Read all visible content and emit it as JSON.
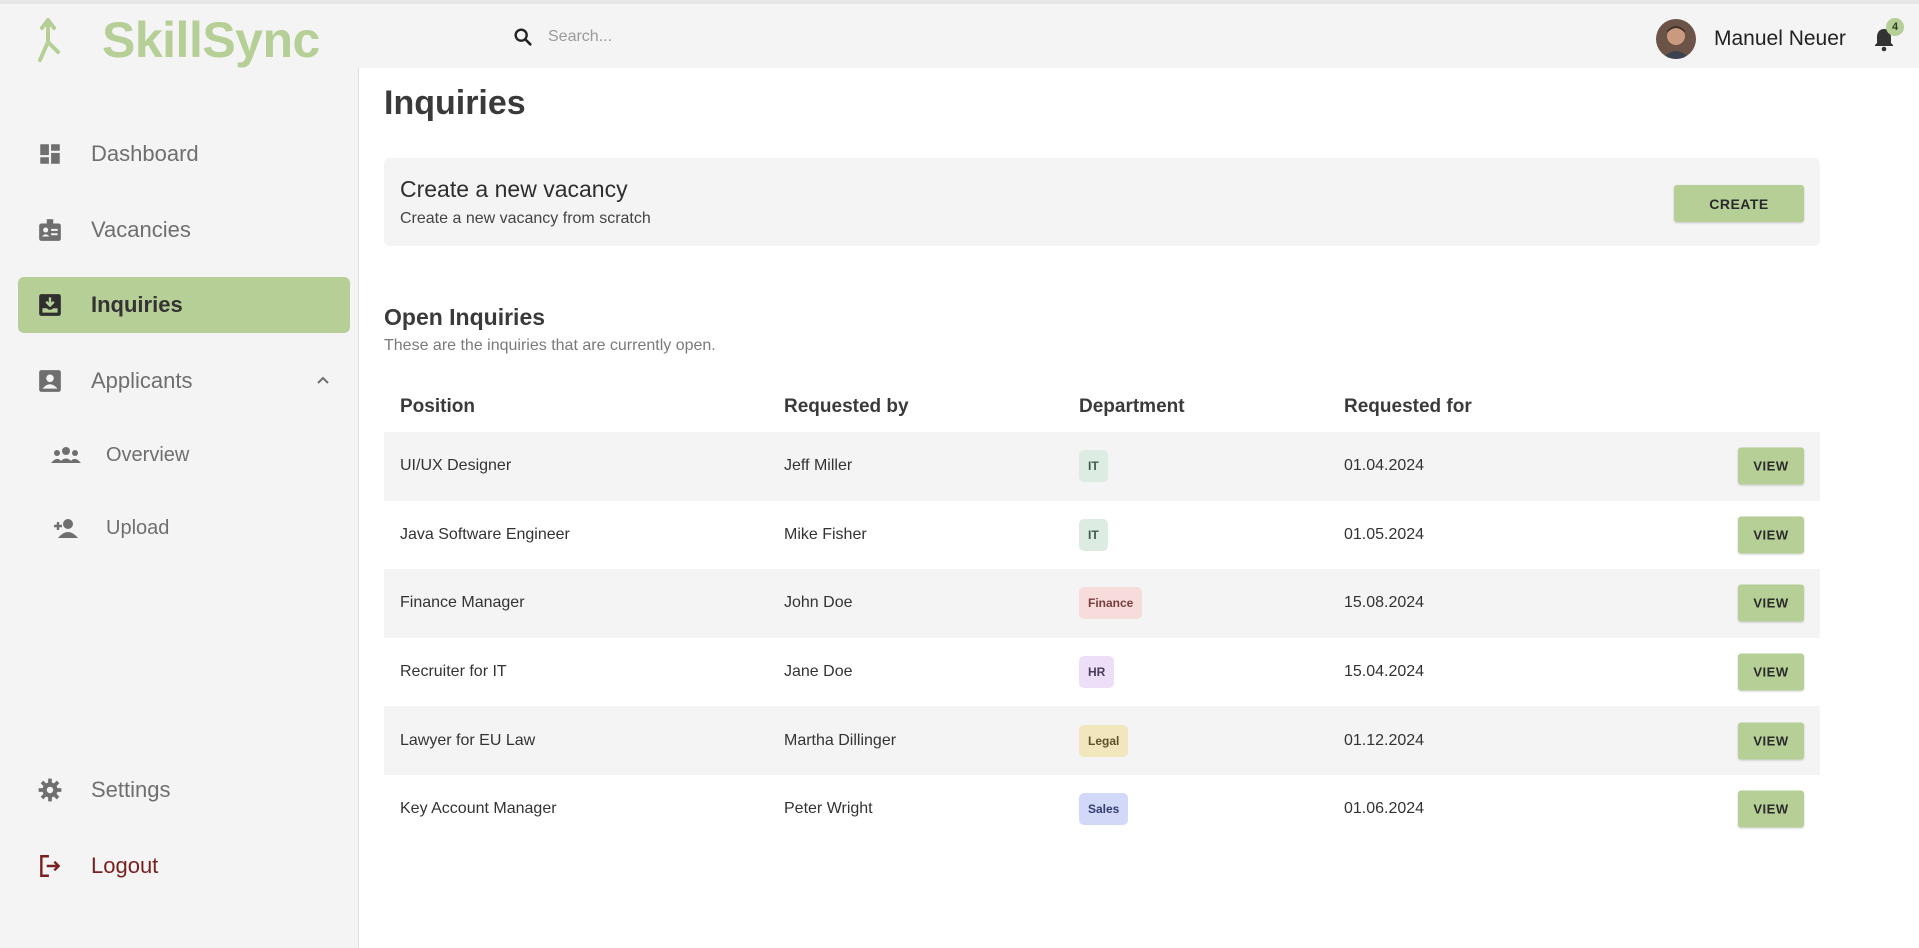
{
  "app": {
    "name": "SkillSync"
  },
  "search": {
    "placeholder": "Search..."
  },
  "user": {
    "name": "Manuel Neuer",
    "notifications": "4"
  },
  "sidebar": {
    "items": [
      {
        "label": "Dashboard",
        "icon": "dashboard-icon"
      },
      {
        "label": "Vacancies",
        "icon": "badge-icon"
      },
      {
        "label": "Inquiries",
        "icon": "inbox-download-icon",
        "active": true
      },
      {
        "label": "Applicants",
        "icon": "contact-card-icon",
        "expanded": true
      }
    ],
    "sub_items": [
      {
        "label": "Overview",
        "icon": "group-icon"
      },
      {
        "label": "Upload",
        "icon": "person-add-icon"
      }
    ],
    "settings": "Settings",
    "logout": "Logout"
  },
  "main": {
    "title": "Inquiries",
    "create_card": {
      "title": "Create a new vacancy",
      "subtitle": "Create a new vacancy from scratch",
      "button": "CREATE"
    },
    "open": {
      "title": "Open Inquiries",
      "subtitle": "These are the inquiries that are currently open."
    },
    "table": {
      "headers": [
        "Position",
        "Requested by",
        "Department",
        "Requested for"
      ],
      "view_label": "VIEW",
      "rows": [
        {
          "position": "UI/UX Designer",
          "requested_by": "Jeff Miller",
          "department": "IT",
          "dept_bg": "#dcece2",
          "dept_fg": "#3e5a46",
          "requested_for": "01.04.2024"
        },
        {
          "position": "Java Software Engineer",
          "requested_by": "Mike Fisher",
          "department": "IT",
          "dept_bg": "#dcece2",
          "dept_fg": "#3e5a46",
          "requested_for": "01.05.2024"
        },
        {
          "position": "Finance Manager",
          "requested_by": "John Doe",
          "department": "Finance",
          "dept_bg": "#f7dcdc",
          "dept_fg": "#7a3d3d",
          "requested_for": "15.08.2024"
        },
        {
          "position": "Recruiter for IT",
          "requested_by": "Jane Doe",
          "department": "HR",
          "dept_bg": "#ecdff7",
          "dept_fg": "#4a3a5e",
          "requested_for": "15.04.2024"
        },
        {
          "position": "Lawyer for EU Law",
          "requested_by": "Martha Dillinger",
          "department": "Legal",
          "dept_bg": "#f2e6bd",
          "dept_fg": "#5e5128",
          "requested_for": "01.12.2024"
        },
        {
          "position": "Key Account Manager",
          "requested_by": "Peter Wright",
          "department": "Sales",
          "dept_bg": "#d2d8f7",
          "dept_fg": "#333d70",
          "requested_for": "01.06.2024"
        }
      ]
    }
  },
  "colors": {
    "accent": "#b5cf96",
    "sidebar_bg": "#f4f4f4",
    "logout": "#7a1f1f"
  }
}
